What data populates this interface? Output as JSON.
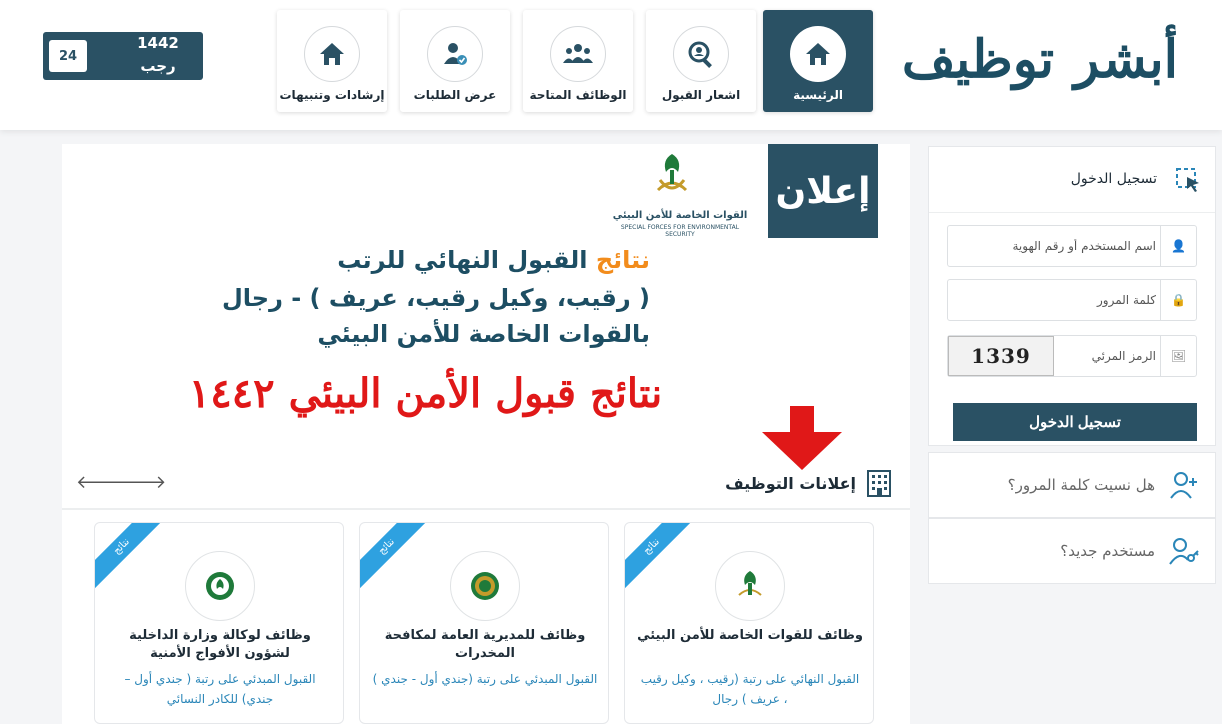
{
  "header": {
    "logo": {
      "word1": "أبشر",
      "word2": "توظيف"
    },
    "nav": [
      {
        "label": "الرئيسية",
        "icon": "home-icon"
      },
      {
        "label": "اشعار القبول",
        "icon": "search-person-icon"
      },
      {
        "label": "الوظائف المتاحة",
        "icon": "group-icon"
      },
      {
        "label": "عرض الطلبات",
        "icon": "user-check-icon"
      },
      {
        "label": "إرشادات وتنبيهات",
        "icon": "home-icon"
      }
    ],
    "date": {
      "day": "24",
      "year": "1442",
      "month": "رجب"
    }
  },
  "banner": {
    "badge": "إعلان",
    "org_ar": "القوات الخاصة للأمن البيئي",
    "org_en": "SPECIAL FORCES FOR ENVIRONMENTAL SECURITY",
    "line1_highlight": "نتائج",
    "line1_rest": "القبول النهائي للرتب",
    "line2": "( رقيب، وكيل رقيب، عريف ) - رجال",
    "line3": "بالقوات الخاصة للأمن البيئي",
    "headline": "نتائج قبول الأمن البيئي ١٤٤٢"
  },
  "jobs_section": {
    "title": "إعلانات التوظيف",
    "cards": [
      {
        "ribbon": "نتائج",
        "title": "وظائف للقوات الخاصة للأمن البيئي",
        "desc": "القبول النهائي على رتبة (رقيب ، وكيل رقيب ، عريف ) رجال"
      },
      {
        "ribbon": "نتائج",
        "title": "وظائف للمديرية العامة لمكافحة المخدرات",
        "desc": "القبول المبدئي على رتبة (جندي أول - جندي )"
      },
      {
        "ribbon": "نتائج",
        "title": "وظائف لوكالة وزارة الداخلية لشؤون الأفواج الأمنية",
        "desc": "القبول المبدئي على رتبة ( جندي أول – جندي) للكادر النسائي"
      }
    ]
  },
  "login": {
    "title": "تسجيل الدخول",
    "username_placeholder": "اسم المستخدم أو رقم الهوية",
    "password_placeholder": "كلمة المرور",
    "captcha_placeholder": "الرمز المرئي",
    "captcha_text": "1339",
    "submit": "تسجيل الدخول"
  },
  "side_links": {
    "forgot": "هل نسيت كلمة المرور؟",
    "new_user": "مستخدم جديد؟"
  },
  "colors": {
    "primary": "#2a5164",
    "accent": "#f28c1c",
    "ribbon": "#2ea1e0",
    "headline": "#e01818"
  }
}
